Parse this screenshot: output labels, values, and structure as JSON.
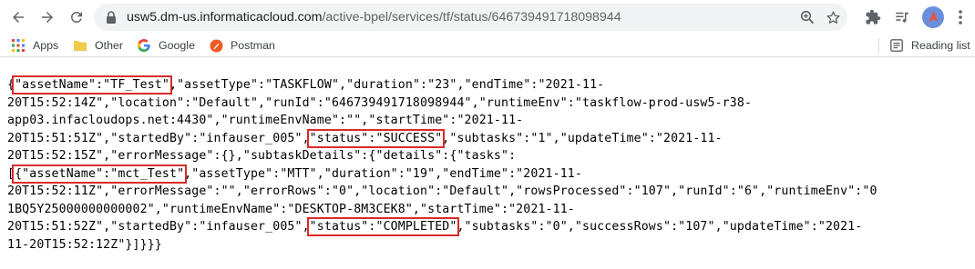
{
  "browser": {
    "url_host": "usw5.dm-us.informaticacloud.com",
    "url_path": "/active-bpel/services/tf/status/646739491718098944",
    "icons": [
      "back-icon",
      "forward-icon",
      "reload-icon",
      "lock-icon",
      "zoom-icon",
      "star-icon",
      "extensions-icon",
      "media-icon",
      "profile-icon",
      "menu-icon"
    ]
  },
  "bookmarks": {
    "items": [
      {
        "label": "Apps",
        "icon": "apps-grid-icon"
      },
      {
        "label": "Other",
        "icon": "folder-icon"
      },
      {
        "label": "Google",
        "icon": "google-icon"
      },
      {
        "label": "Postman",
        "icon": "postman-icon"
      }
    ],
    "reading_list": "Reading list"
  },
  "colors": {
    "highlight_box": "#d92b2b",
    "omnibox_bg": "#f1f3f4"
  },
  "json_lines": [
    {
      "segments": [
        {
          "t": "{"
        },
        {
          "t": "\"assetName\":\"TF_Test\"",
          "hl": true
        },
        {
          "t": ",\"assetType\":\"TASKFLOW\",\"duration\":\"23\",\"endTime\":\"2021-11-"
        }
      ]
    },
    {
      "segments": [
        {
          "t": "20T15:52:14Z\",\"location\":\"Default\",\"runId\":\"646739491718098944\",\"runtimeEnv\":\"taskflow-prod-usw5-r38-"
        }
      ]
    },
    {
      "segments": [
        {
          "t": "app03.infacloudops.net:4430\",\"runtimeEnvName\":\"\",\"startTime\":\"2021-11-"
        }
      ]
    },
    {
      "segments": [
        {
          "t": "20T15:51:51Z\",\"startedBy\":\"infauser_005\","
        },
        {
          "t": "\"status\":\"SUCCESS\"",
          "hl": true
        },
        {
          "t": ",\"subtasks\":\"1\",\"updateTime\":\"2021-11-"
        }
      ]
    },
    {
      "segments": [
        {
          "t": "20T15:52:15Z\",\"errorMessage\":{},\"subtaskDetails\":{\"details\":{\"tasks\":"
        }
      ]
    },
    {
      "segments": [
        {
          "t": "["
        },
        {
          "t": "{\"assetName\":\"mct_Test\"",
          "hl": true
        },
        {
          "t": ",\"assetType\":\"MTT\",\"duration\":\"19\",\"endTime\":\"2021-11-"
        }
      ]
    },
    {
      "segments": [
        {
          "t": "20T15:52:11Z\",\"errorMessage\":\"\",\"errorRows\":\"0\",\"location\":\"Default\",\"rowsProcessed\":\"107\",\"runId\":\"6\",\"runtimeEnv\":\"0"
        }
      ]
    },
    {
      "segments": [
        {
          "t": "1BQ5Y25000000000002\",\"runtimeEnvName\":\"DESKTOP-8M3CEK8\",\"startTime\":\"2021-11-"
        }
      ]
    },
    {
      "segments": [
        {
          "t": "20T15:51:52Z\",\"startedBy\":\"infauser_005\","
        },
        {
          "t": "\"status\":\"COMPLETED\"",
          "hl": true
        },
        {
          "t": ",\"subtasks\":\"0\",\"successRows\":\"107\",\"updateTime\":\"2021-"
        }
      ]
    },
    {
      "segments": [
        {
          "t": "11-20T15:52:12Z\"}]}}}"
        }
      ]
    }
  ]
}
